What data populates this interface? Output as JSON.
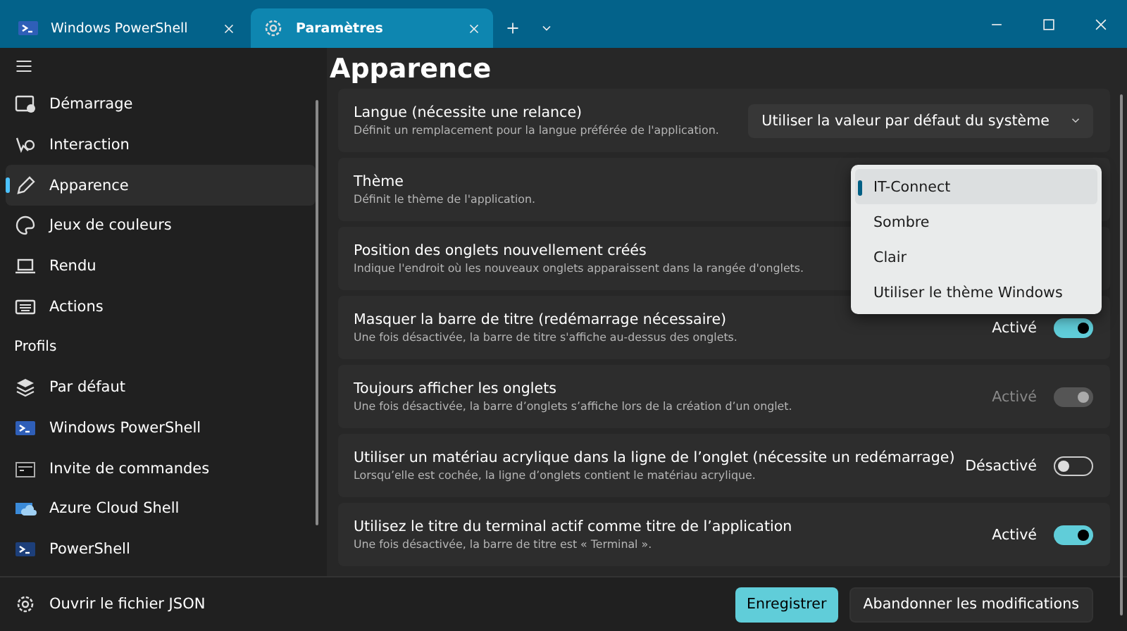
{
  "tabs": [
    {
      "label": "Windows PowerShell",
      "selected": false
    },
    {
      "label": "Paramètres",
      "selected": true
    }
  ],
  "sidebar": {
    "items": [
      {
        "label": "Démarrage",
        "selected": false
      },
      {
        "label": "Interaction",
        "selected": false
      },
      {
        "label": "Apparence",
        "selected": true
      },
      {
        "label": "Jeux de couleurs",
        "selected": false
      },
      {
        "label": "Rendu",
        "selected": false
      },
      {
        "label": "Actions",
        "selected": false
      }
    ],
    "profiles_heading": "Profils",
    "profiles": [
      {
        "label": "Par défaut",
        "selected": false
      },
      {
        "label": "Windows PowerShell",
        "selected": false
      },
      {
        "label": "Invite de commandes",
        "selected": false
      },
      {
        "label": "Azure Cloud Shell",
        "selected": false
      },
      {
        "label": "PowerShell",
        "selected": false
      }
    ],
    "footer_link": "Ouvrir le fichier JSON"
  },
  "page": {
    "title": "Apparence",
    "settings": [
      {
        "title": "Langue (nécessite une relance)",
        "description": "Définit un remplacement pour la langue préférée de l'application.",
        "control": {
          "kind": "dropdown",
          "value": "Utiliser la valeur par défaut du système"
        }
      },
      {
        "title": "Thème",
        "description": "Définit le thème de l'application."
      },
      {
        "title": "Position des onglets nouvellement créés",
        "description": "Indique l'endroit où les nouveaux onglets apparaissent dans la rangée d'onglets."
      },
      {
        "title": "Masquer la barre de titre (redémarrage nécessaire)",
        "description": "Une fois désactivée, la barre de titre s'affiche au-dessus des onglets.",
        "control": {
          "kind": "toggle",
          "state_label": "Activé",
          "on": true,
          "disabled": false
        }
      },
      {
        "title": "Toujours afficher les onglets",
        "description": "Une fois désactivée, la barre d’onglets s’affiche lors de la création d’un onglet.",
        "control": {
          "kind": "toggle",
          "state_label": "Activé",
          "on": true,
          "disabled": true
        }
      },
      {
        "title": "Utiliser un matériau acrylique dans la ligne de l’onglet (nécessite un redémarrage)",
        "description": "Lorsqu’elle est cochée, la ligne d’onglets contient le matériau acrylique.",
        "control": {
          "kind": "toggle",
          "state_label": "Désactivé",
          "on": false,
          "disabled": false
        }
      },
      {
        "title": "Utilisez le titre du terminal actif comme titre de l’application",
        "description": "Une fois désactivée, la barre de titre est « Terminal ».",
        "control": {
          "kind": "toggle",
          "state_label": "Activé",
          "on": true,
          "disabled": false
        }
      }
    ]
  },
  "theme_menu": {
    "options": [
      {
        "label": "IT-Connect",
        "selected": true
      },
      {
        "label": "Sombre",
        "selected": false
      },
      {
        "label": "Clair",
        "selected": false
      },
      {
        "label": "Utiliser le thème Windows",
        "selected": false
      }
    ]
  },
  "buttons": [
    {
      "label": "Enregistrer",
      "kind": "primary"
    },
    {
      "label": "Abandonner les modifications",
      "kind": "secondary"
    }
  ]
}
